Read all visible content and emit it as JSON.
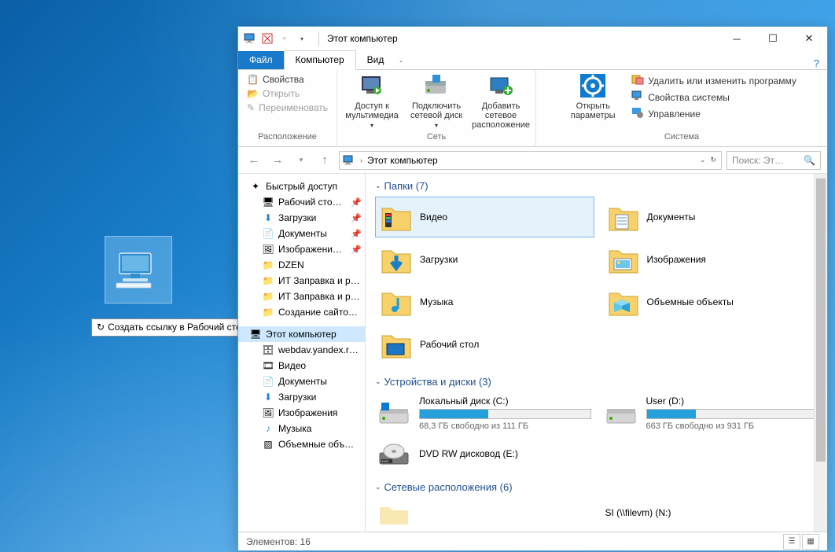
{
  "desktop": {
    "tooltip": "Создать ссылку в Рабочий стол"
  },
  "titlebar": {
    "title": "Этот компьютер"
  },
  "tabs": {
    "file": "Файл",
    "computer": "Компьютер",
    "view": "Вид"
  },
  "ribbon": {
    "group_location": "Расположение",
    "location_items": {
      "properties": "Свойства",
      "open": "Открыть",
      "rename": "Переименовать"
    },
    "group_network": "Сеть",
    "network_big": {
      "media": "Доступ к мультимедиа",
      "mapdrive": "Подключить сетевой диск",
      "addloc": "Добавить сетевое расположение"
    },
    "group_system": "Система",
    "system_big": "Открыть параметры",
    "system_items": {
      "uninstall": "Удалить или изменить программу",
      "sysprops": "Свойства системы",
      "manage": "Управление"
    }
  },
  "addr": {
    "root": "Этот компьютер",
    "search_placeholder": "Поиск: Эт…"
  },
  "tree": {
    "quick": "Быстрый доступ",
    "items": [
      "Рабочий сто…",
      "Загрузки",
      "Документы",
      "Изображени…",
      "DZEN",
      "ИТ Заправка и р…",
      "ИТ Заправка и р…",
      "Создание сайто…"
    ],
    "thispc": "Этот компьютер",
    "under_pc": [
      "webdav.yandex.r…",
      "Видео",
      "Документы",
      "Загрузки",
      "Изображения",
      "Музыка",
      "Объемные объ…"
    ]
  },
  "sections": {
    "folders_hdr": "Папки (7)",
    "drives_hdr": "Устройства и диски (3)",
    "netloc_hdr": "Сетевые расположения (6)"
  },
  "folders": {
    "video": "Видео",
    "documents": "Документы",
    "downloads": "Загрузки",
    "pictures": "Изображения",
    "music": "Музыка",
    "objects3d": "Объемные объекты",
    "desktop": "Рабочий стол"
  },
  "drives": {
    "c": {
      "name": "Локальный диск (C:)",
      "free": "68,3 ГБ свободно из 111 ГБ",
      "fill_pct": 40
    },
    "d": {
      "name": "User (D:)",
      "free": "663 ГБ свободно из 931 ГБ",
      "fill_pct": 29
    },
    "dvd": {
      "name": "DVD RW дисковод (E:)"
    }
  },
  "netloc": {
    "item2": "SI (\\\\filevm) (N:)"
  },
  "status": {
    "elements": "Элементов: 16"
  }
}
